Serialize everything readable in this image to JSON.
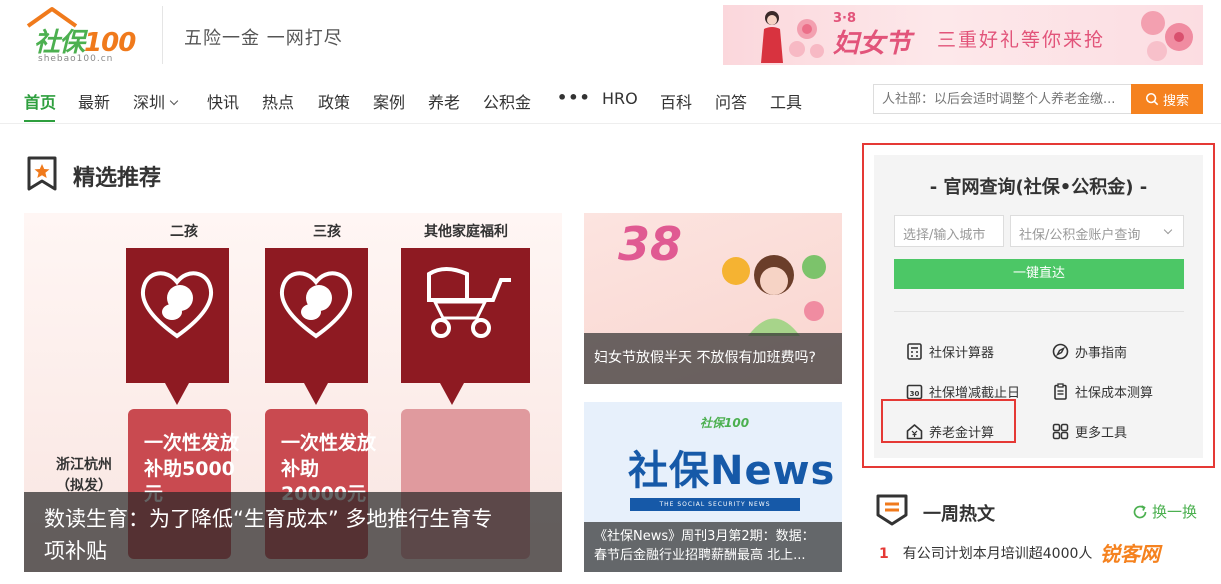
{
  "header": {
    "logo_text": "社保",
    "logo_num": "100",
    "logo_sub": "shebao100.cn",
    "slogan": "五险一金 一网打尽",
    "banner": {
      "badge": "3·8",
      "title": "妇女节",
      "subtitle": "三重好礼等你来抢"
    }
  },
  "nav": {
    "items": [
      "首页",
      "最新",
      "深圳",
      "快讯",
      "热点",
      "政策",
      "案例",
      "养老",
      "公积金",
      "•••",
      "HRO",
      "百科",
      "问答",
      "工具"
    ],
    "active": "首页"
  },
  "search": {
    "placeholder": "人社部：以后会适时调整个人养老金缴...",
    "button_label": "搜索"
  },
  "section": {
    "title": "精选推荐"
  },
  "feature": {
    "col_labels": [
      "二孩",
      "三孩",
      "其他家庭福利"
    ],
    "city": "浙江杭州",
    "city_note": "（拟发）",
    "pay1_line1": "一次性发放",
    "pay1_line2": "补助5000",
    "pay1_line3": "元",
    "pay2_line1": "一次性发放",
    "pay2_line2": "补助",
    "pay2_line3": "20000元",
    "caption_line1": "数读生育：为了降低“生育成本” 多地推行生育专",
    "caption_line2": "项补贴"
  },
  "cards": [
    {
      "badge": "38",
      "caption": "妇女节放假半天 不放假有加班费吗?"
    },
    {
      "logo": "社保100",
      "title": "社保News",
      "bar_text": "THE SOCIAL SECURITY NEWS",
      "caption_line1": "《社保News》周刊3月第2期：数据：",
      "caption_line2": "春节后金融行业招聘薪酬最高 北上..."
    }
  ],
  "query": {
    "title": "- 官网查询(社保•公积金) -",
    "city_placeholder": "选择/输入城市",
    "account_placeholder": "社保/公积金账户查询",
    "go_button": "一键直达",
    "tools": [
      {
        "label": "社保计算器",
        "icon": "calculator-icon"
      },
      {
        "label": "办事指南",
        "icon": "compass-icon"
      },
      {
        "label": "社保增减截止日",
        "icon": "calendar-30-icon"
      },
      {
        "label": "社保成本测算",
        "icon": "clipboard-icon"
      },
      {
        "label": "养老金计算",
        "icon": "house-yen-icon"
      },
      {
        "label": "更多工具",
        "icon": "grid-icon"
      }
    ]
  },
  "weekly": {
    "title": "一周热文",
    "refresh_label": "换一换",
    "items": [
      {
        "rank": "1",
        "text": "有公司计划本月培训超4000人"
      }
    ]
  },
  "watermark": "锐客网",
  "colors": {
    "brand_green": "#2e9f3e",
    "accent_orange": "#f5821f",
    "button_green": "#4cc766",
    "highlight_red": "#e53935",
    "news_blue": "#1659a8"
  }
}
